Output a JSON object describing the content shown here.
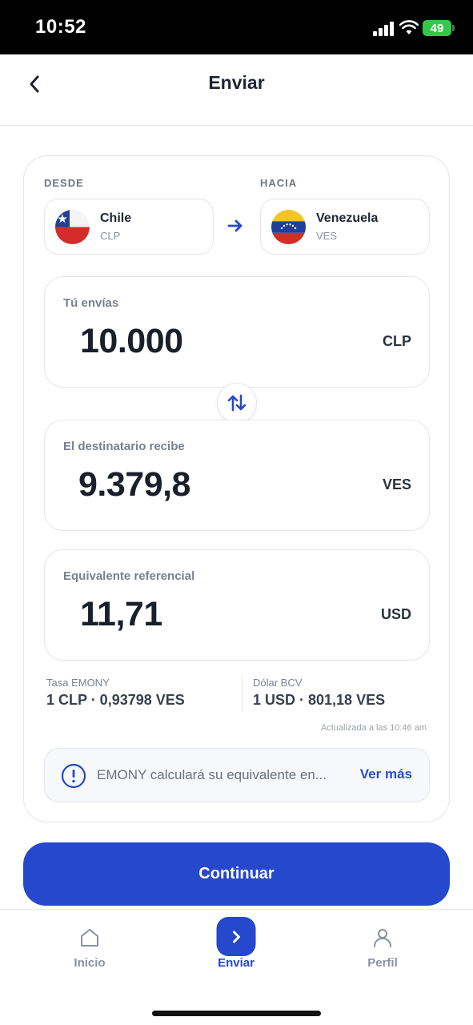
{
  "status_bar": {
    "time": "10:52",
    "battery": "49"
  },
  "header": {
    "title": "Enviar"
  },
  "from": {
    "label": "DESDE",
    "country": "Chile",
    "currency": "CLP"
  },
  "to": {
    "label": "HACIA",
    "country": "Venezuela",
    "currency": "VES"
  },
  "send": {
    "label": "Tú envías",
    "amount": "10.000",
    "currency": "CLP"
  },
  "receive": {
    "label": "El destinatario recibe",
    "amount": "9.379,8",
    "currency": "VES"
  },
  "reference": {
    "label": "Equivalente referencial",
    "amount": "11,71",
    "currency": "USD"
  },
  "rates": {
    "emony_label": "Tasa EMONY",
    "emony_value": "1 CLP · 0,93798 VES",
    "bcv_label": "Dólar BCV",
    "bcv_value": "1 USD · 801,18 VES",
    "updated": "Actualizada a las 10:46 am"
  },
  "info": {
    "text": "EMONY calculará su equivalente en...",
    "link": "Ver más"
  },
  "continue_label": "Continuar",
  "nav": {
    "items": [
      {
        "label": "Inicio"
      },
      {
        "label": "Enviar"
      },
      {
        "label": "Perfil"
      }
    ]
  },
  "colors": {
    "primary": "#2648cc",
    "text": "#1f2433",
    "muted": "#8a90a0",
    "border": "#e3e6ee"
  }
}
